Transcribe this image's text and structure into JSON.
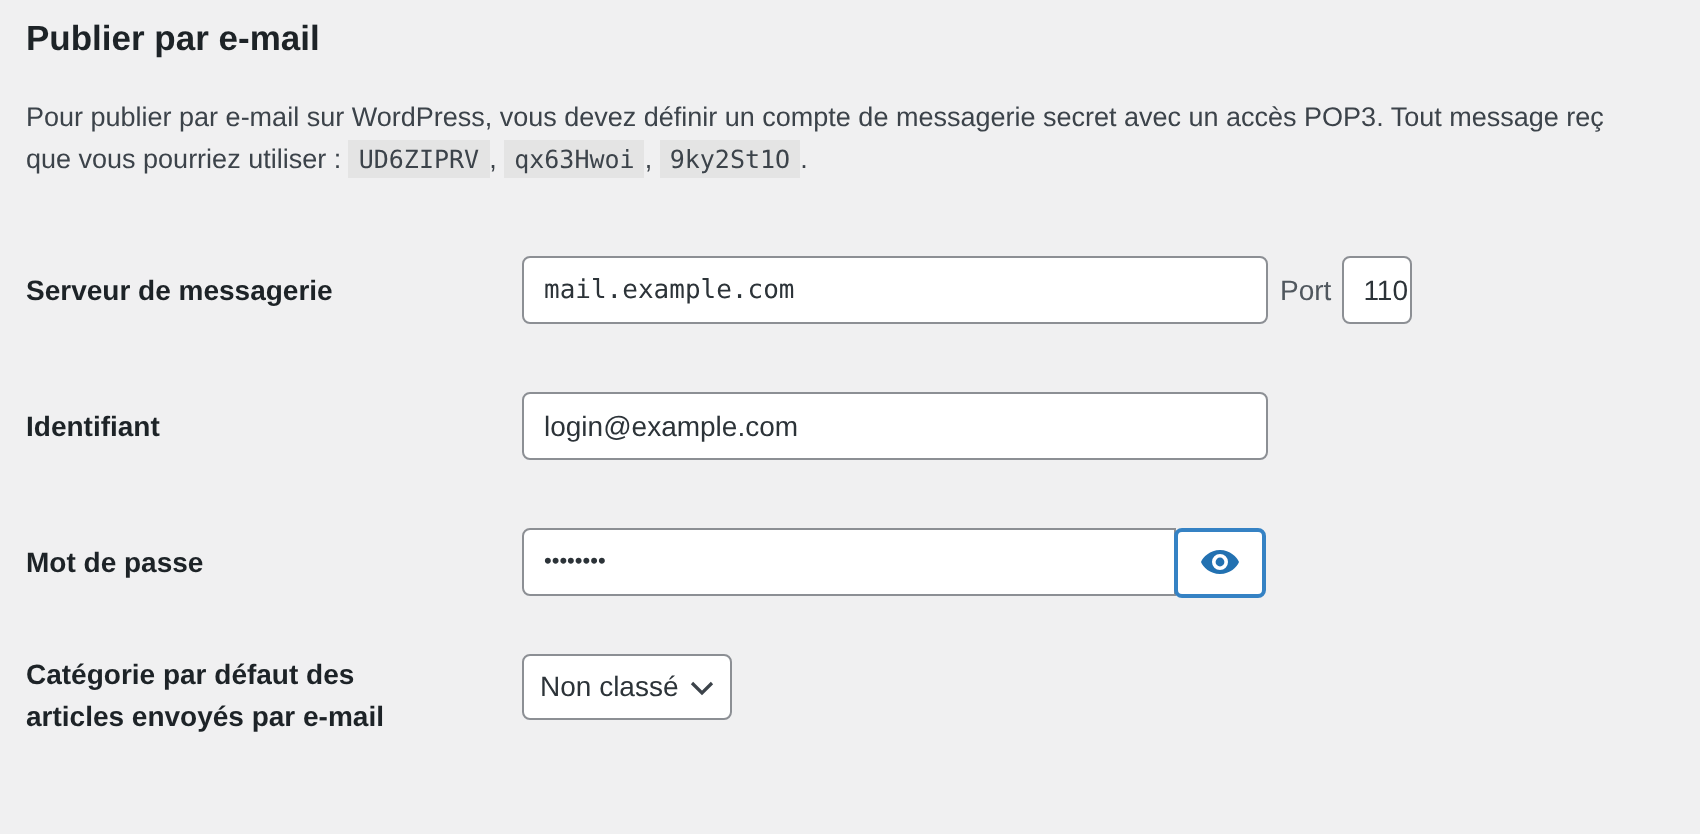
{
  "heading": "Publier par e-mail",
  "intro": {
    "line_1": "Pour publier par e-mail sur WordPress, vous devez définir un compte de messagerie secret avec un accès POP3. Tout message reç",
    "line_2_start": "que vous pourriez utiliser :",
    "codes": [
      "UD6ZIPRV",
      "qx63Hwoi",
      "9ky2St1O"
    ],
    "separator": ",",
    "end": "."
  },
  "fields": [
    {
      "kind": "server",
      "label": "Serveur de messagerie",
      "value": "mail.example.com",
      "port_label": "Port",
      "port_value": "110"
    },
    {
      "kind": "text",
      "label": "Identifiant",
      "value": "login@example.com"
    },
    {
      "kind": "password",
      "label": "Mot de passe",
      "value": "••••••••",
      "show_button_focused": true
    },
    {
      "kind": "select",
      "label": "Catégorie par défaut des articles envoyés par e-mail",
      "value": "Non classé"
    }
  ]
}
